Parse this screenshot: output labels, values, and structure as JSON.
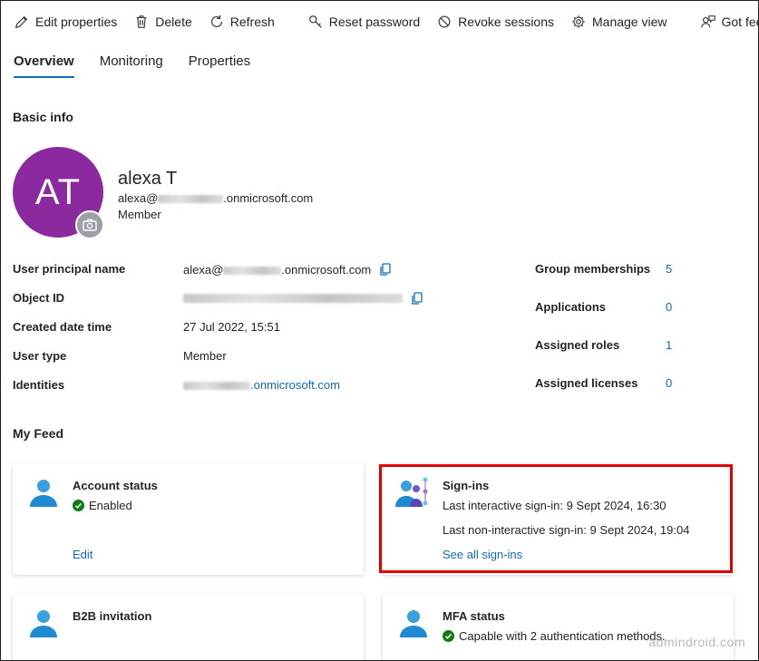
{
  "toolbar": {
    "edit_properties": "Edit properties",
    "delete": "Delete",
    "refresh": "Refresh",
    "reset_password": "Reset password",
    "revoke_sessions": "Revoke sessions",
    "manage_view": "Manage view",
    "got_feedback": "Got feedback?"
  },
  "tabs": [
    "Overview",
    "Monitoring",
    "Properties"
  ],
  "active_tab": "Overview",
  "basic_info": {
    "title": "Basic info",
    "avatar_initials": "AT",
    "avatar_color": "#8a2a9e",
    "name": "alexa T",
    "email_prefix": "alexa@",
    "email_suffix": ".onmicrosoft.com",
    "role": "Member"
  },
  "properties": {
    "upn_label": "User principal name",
    "upn_prefix": "alexa@",
    "upn_suffix": ".onmicrosoft.com",
    "object_id_label": "Object ID",
    "created_label": "Created date time",
    "created_value": "27 Jul 2022, 15:51",
    "user_type_label": "User type",
    "user_type_value": "Member",
    "identities_label": "Identities",
    "identities_suffix": ".onmicrosoft.com"
  },
  "stats": {
    "group_label": "Group memberships",
    "group_value": "5",
    "apps_label": "Applications",
    "apps_value": "0",
    "roles_label": "Assigned roles",
    "roles_value": "1",
    "licenses_label": "Assigned licenses",
    "licenses_value": "0"
  },
  "feed": {
    "title": "My Feed",
    "account_status": {
      "title": "Account status",
      "status": "Enabled",
      "link": "Edit"
    },
    "signins": {
      "title": "Sign-ins",
      "last_interactive": "Last interactive sign-in: 9 Sept 2024, 16:30",
      "last_noninteractive": "Last non-interactive sign-in: 9 Sept 2024, 19:04",
      "link": "See all sign-ins"
    },
    "b2b": {
      "title": "B2B invitation"
    },
    "mfa": {
      "title": "MFA status",
      "status": "Capable with 2 authentication methods."
    }
  },
  "watermark": "admindroid.com",
  "colors": {
    "accent": "#0f6cbd",
    "highlight": "#e00000",
    "success": "#107c10"
  }
}
